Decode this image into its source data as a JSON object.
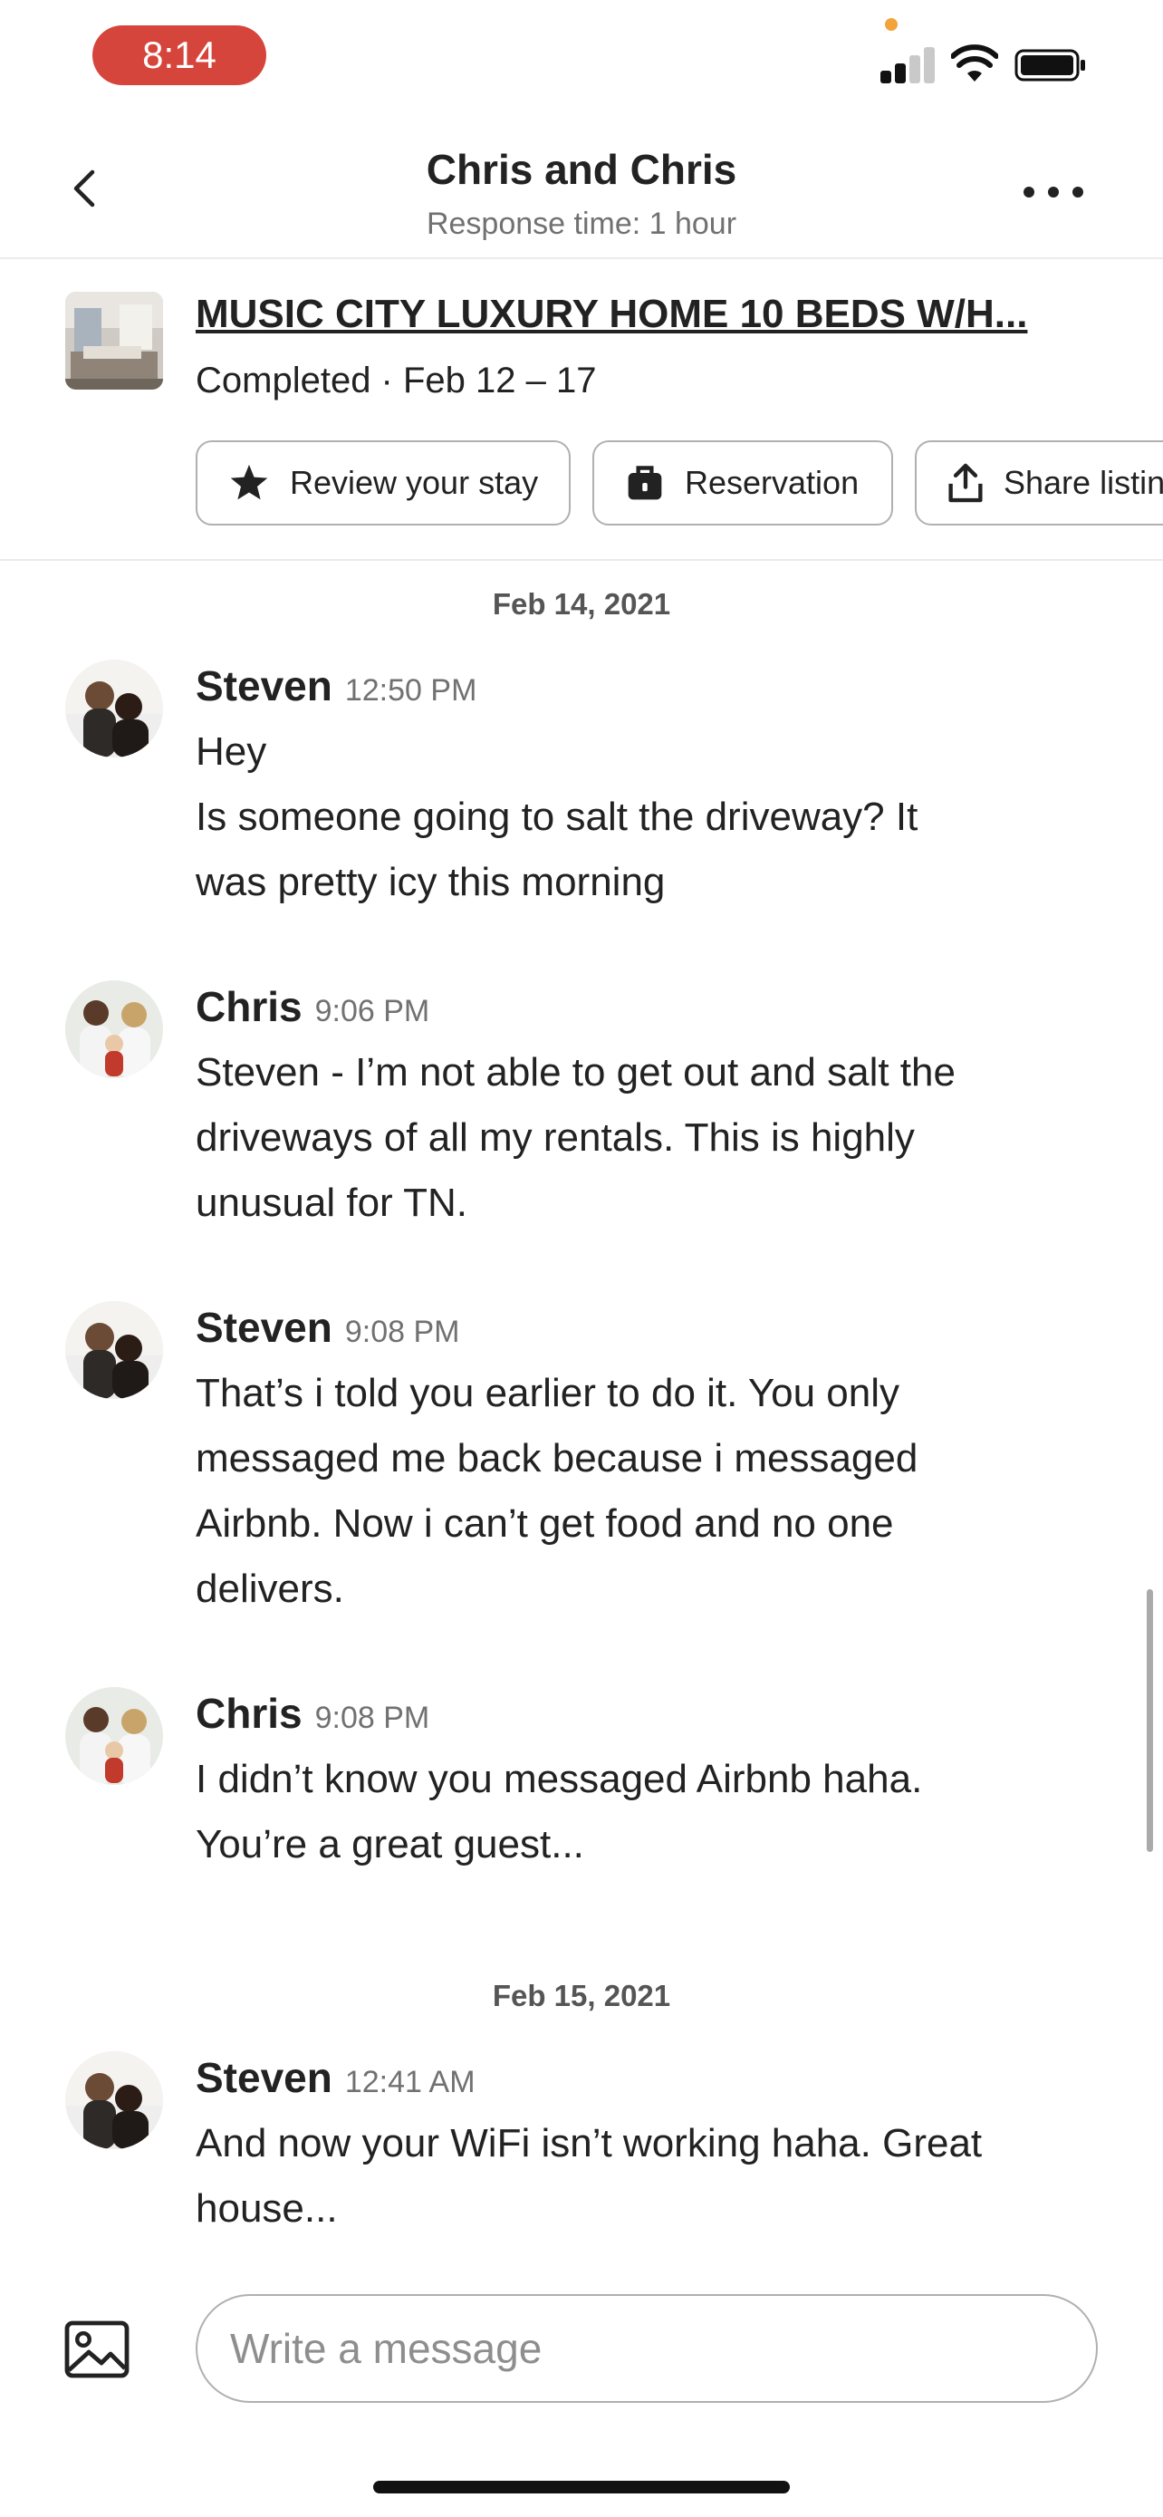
{
  "status_bar": {
    "time": "8:14"
  },
  "header": {
    "title": "Chris and Chris",
    "subtitle": "Response time: 1 hour",
    "back_icon": "chevron-left-icon",
    "more_icon": "more-horizontal-icon"
  },
  "listing": {
    "title": "MUSIC CITY LUXURY HOME 10 BEDS W/H...",
    "status_dates": "Completed · Feb 12 – 17",
    "actions": [
      {
        "label": "Review your stay",
        "icon": "star-icon"
      },
      {
        "label": "Reservation",
        "icon": "briefcase-icon"
      },
      {
        "label": "Share listin",
        "icon": "share-icon"
      }
    ]
  },
  "conversation": {
    "day1": {
      "date": "Feb 14, 2021",
      "messages": [
        {
          "sender": "Steven",
          "time": "12:50 PM",
          "lines": [
            "Hey",
            "Is someone going to salt the driveway?  It",
            "was pretty icy this morning"
          ]
        },
        {
          "sender": "Chris",
          "time": "9:06 PM",
          "lines": [
            "Steven - I’m not able to get out and salt the",
            "driveways of all my rentals. This is highly",
            "unusual for TN."
          ]
        },
        {
          "sender": "Steven",
          "time": "9:08 PM",
          "lines": [
            "That’s i told you earlier to do it. You only",
            "messaged me back because i messaged",
            "Airbnb. Now i can’t get food and no one",
            "delivers."
          ]
        },
        {
          "sender": "Chris",
          "time": "9:08 PM",
          "lines": [
            "I didn’t know you messaged Airbnb haha.",
            "You’re a great guest..."
          ]
        }
      ]
    },
    "day2": {
      "date": "Feb 15, 2021",
      "messages": [
        {
          "sender": "Steven",
          "time": "12:41 AM",
          "lines": [
            "And now your WiFi isn’t working haha. Great",
            "house..."
          ]
        }
      ]
    }
  },
  "composer": {
    "placeholder": "Write a message",
    "value": "",
    "attach_icon": "image-icon"
  },
  "colors": {
    "time_pill": "#d6453b",
    "text_primary": "#222222",
    "text_secondary": "#717171",
    "border": "#b0b0b0"
  }
}
